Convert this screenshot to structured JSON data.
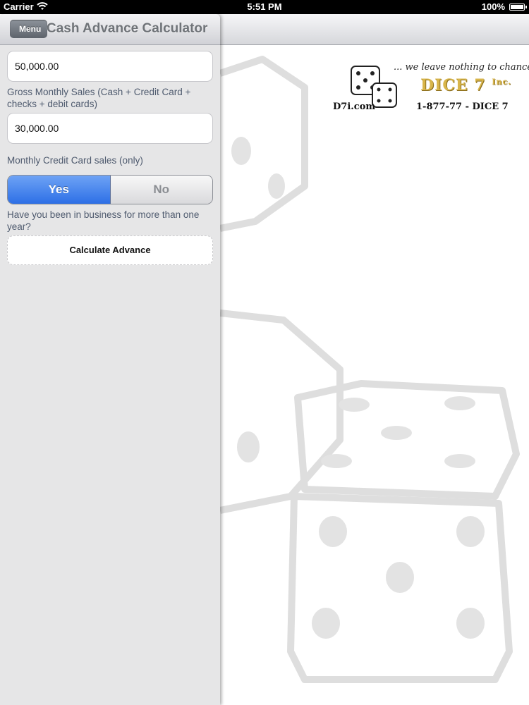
{
  "status_bar": {
    "carrier": "Carrier",
    "time": "5:51 PM",
    "battery": "100%"
  },
  "master": {
    "back_label": "Menu",
    "title": "Cash Advance Calculator",
    "fields": [
      {
        "value": "50,000.00",
        "label": "Gross Monthly Sales (Cash + Credit Card + checks + debit cards)"
      },
      {
        "value": "30,000.00",
        "label": "Monthly Credit Card sales (only)"
      }
    ],
    "segmented": {
      "yes": "Yes",
      "no": "No",
      "selected": "Yes"
    },
    "question": "Have you been in business for more than one year?",
    "calculate_label": "Calculate Advance"
  },
  "logo": {
    "tagline": "... we leave nothing to chance.",
    "brand": "DICE 7",
    "brand_suffix": "Inc.",
    "site": "D7i.com",
    "phone": "1-877-77 - DICE 7",
    "brand_color": "#d8b54a"
  }
}
